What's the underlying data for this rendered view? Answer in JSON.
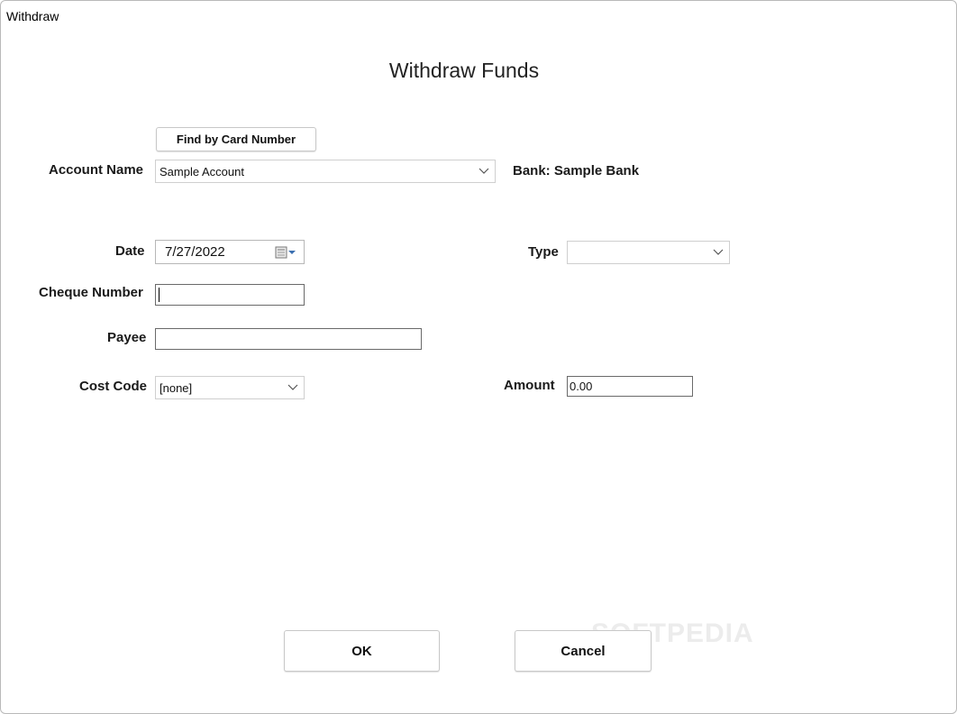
{
  "window": {
    "title": "Withdraw"
  },
  "heading": "Withdraw Funds",
  "find_button": "Find by Card Number",
  "account": {
    "label": "Account Name",
    "value": "Sample Account",
    "bank": "Bank: Sample Bank"
  },
  "date": {
    "label": "Date",
    "value": "7/27/2022"
  },
  "type": {
    "label": "Type",
    "value": ""
  },
  "cheque": {
    "label": "Cheque Number",
    "value": ""
  },
  "payee": {
    "label": "Payee",
    "value": ""
  },
  "cost_code": {
    "label": "Cost Code",
    "value": "[none]"
  },
  "amount": {
    "label": "Amount",
    "value": "0.00"
  },
  "buttons": {
    "ok": "OK",
    "cancel": "Cancel"
  },
  "watermark": "SOFTPEDIA",
  "icons": {
    "calendar": "calendar-icon",
    "dropdown": "chevron-down-icon"
  }
}
